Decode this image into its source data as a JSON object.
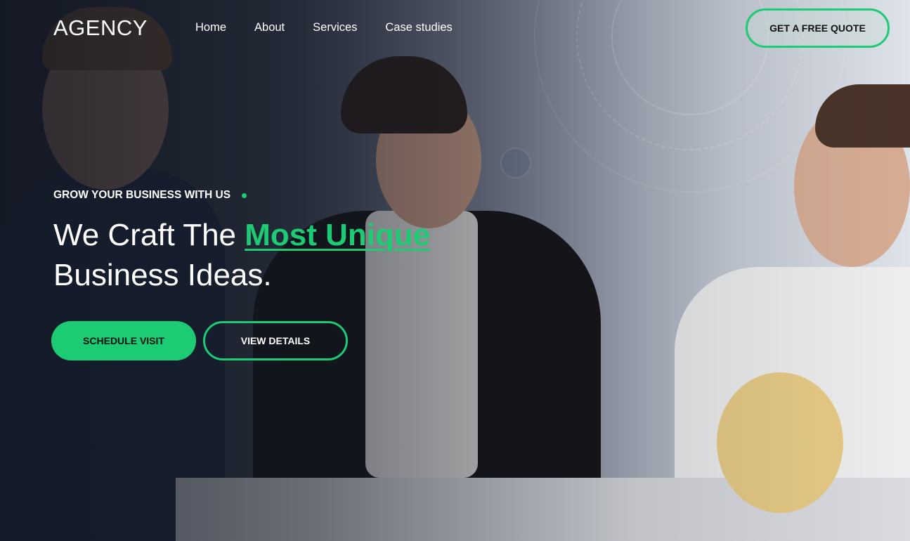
{
  "header": {
    "logo": "AGENCY",
    "nav": [
      {
        "label": "Home"
      },
      {
        "label": "About"
      },
      {
        "label": "Services"
      },
      {
        "label": "Case studies"
      }
    ],
    "cta_label": "GET A FREE QUOTE"
  },
  "hero": {
    "eyebrow": "GROW YOUR BUSINESS WITH US",
    "headline_part1": "We Craft The ",
    "headline_highlight": "Most Unique ",
    "headline_part2": "Business Ideas.",
    "primary_button": "SCHEDULE VISIT",
    "secondary_button": "VIEW DETAILS"
  },
  "colors": {
    "accent": "#1ccb73",
    "text": "#ffffff",
    "overlay": "#121622"
  }
}
